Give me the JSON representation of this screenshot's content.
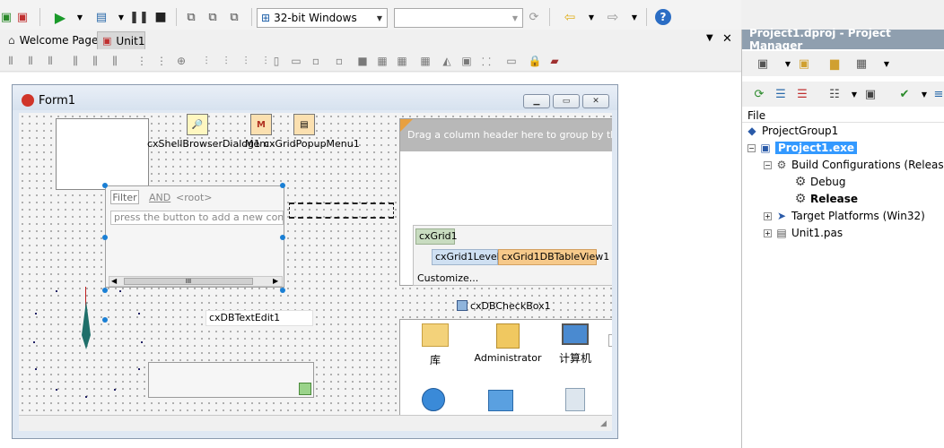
{
  "toolbar": {
    "platform_combo": "32-bit Windows",
    "config_combo": ""
  },
  "tabs": [
    {
      "label": "Welcome Page"
    },
    {
      "label": "Unit1"
    }
  ],
  "form": {
    "title": "Form1"
  },
  "components": {
    "shell_browser_label": "cxShellBrowserDialog1",
    "mem_label": "Mem",
    "popup_label": "cxGridPopupMenu1",
    "filter_button": "Filter",
    "filter_and": "AND",
    "filter_root": "<root>",
    "filter_hint": "press the button to add a new condition",
    "scroll_thumb": "III",
    "dbtextedit": "cxDBTextEdit1",
    "dbcheckbox": "cxDBCheckBox1"
  },
  "grid": {
    "group_hint": "Drag a column header here to group by that co",
    "root_node": "cxGrid1",
    "level_node": "cxGrid1Level1",
    "view_node": "cxGrid1DBTableView1",
    "customize": "Customize..."
  },
  "shell_list": {
    "items": [
      {
        "label": "库",
        "icon": "library-icon"
      },
      {
        "label": "Administrator",
        "icon": "user-folder-icon"
      },
      {
        "label": "计算机",
        "icon": "computer-icon"
      }
    ]
  },
  "project_manager": {
    "title": "Project1.dproj - Project Manager",
    "file_header": "File",
    "tree": {
      "group": "ProjectGroup1",
      "project": "Project1.exe",
      "build_configs": "Build Configurations (Release)",
      "debug": "Debug",
      "release": "Release",
      "target_platforms": "Target Platforms (Win32)",
      "unit": "Unit1.pas"
    }
  }
}
